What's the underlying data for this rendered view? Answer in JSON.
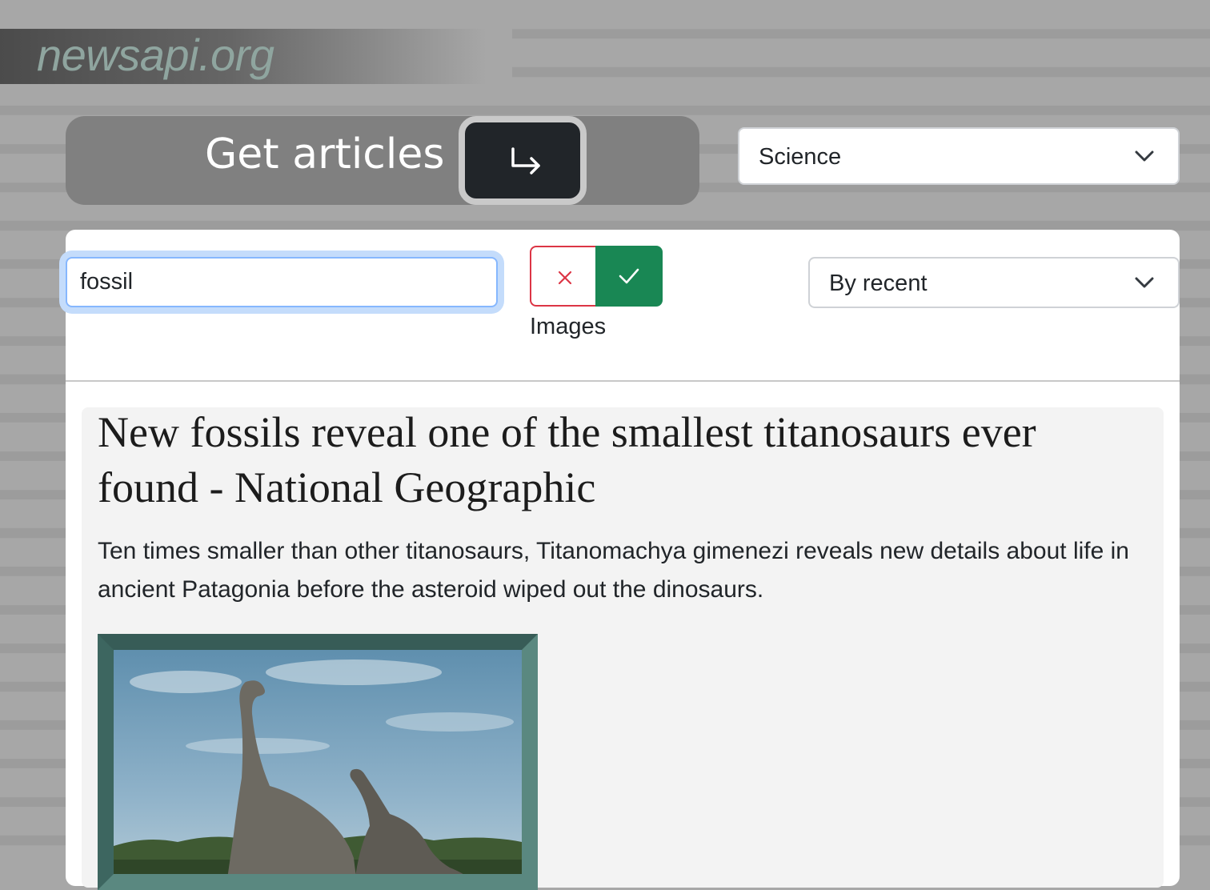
{
  "brand": {
    "text": "newsapi.org"
  },
  "header": {
    "get_label": "Get articles",
    "go_icon": "return-arrow-icon",
    "category": {
      "value": "Science",
      "icon": "chevron-down-icon"
    }
  },
  "filters": {
    "search": {
      "value": "fossil"
    },
    "images_toggle": {
      "off_icon": "x-icon",
      "on_icon": "check-icon",
      "label": "Images",
      "state": "on"
    },
    "sort": {
      "value": "By recent",
      "icon": "chevron-down-icon"
    }
  },
  "article": {
    "title": "New fossils reveal one of the smallest titanosaurs ever found - National Geographic",
    "description": "Ten times smaller than other titanosaurs, Titanomachya gimenezi reveals new details about life in ancient Patagonia before the asteroid wiped out the dinosaurs.",
    "image": {
      "subject": "titanosaur-dinosaurs-photo"
    }
  },
  "colors": {
    "toggle_off_border": "#dc3545",
    "toggle_on_bg": "#198754",
    "focus_ring": "#86b7fe",
    "button_dark": "#212529",
    "image_frame": "#45706a"
  }
}
